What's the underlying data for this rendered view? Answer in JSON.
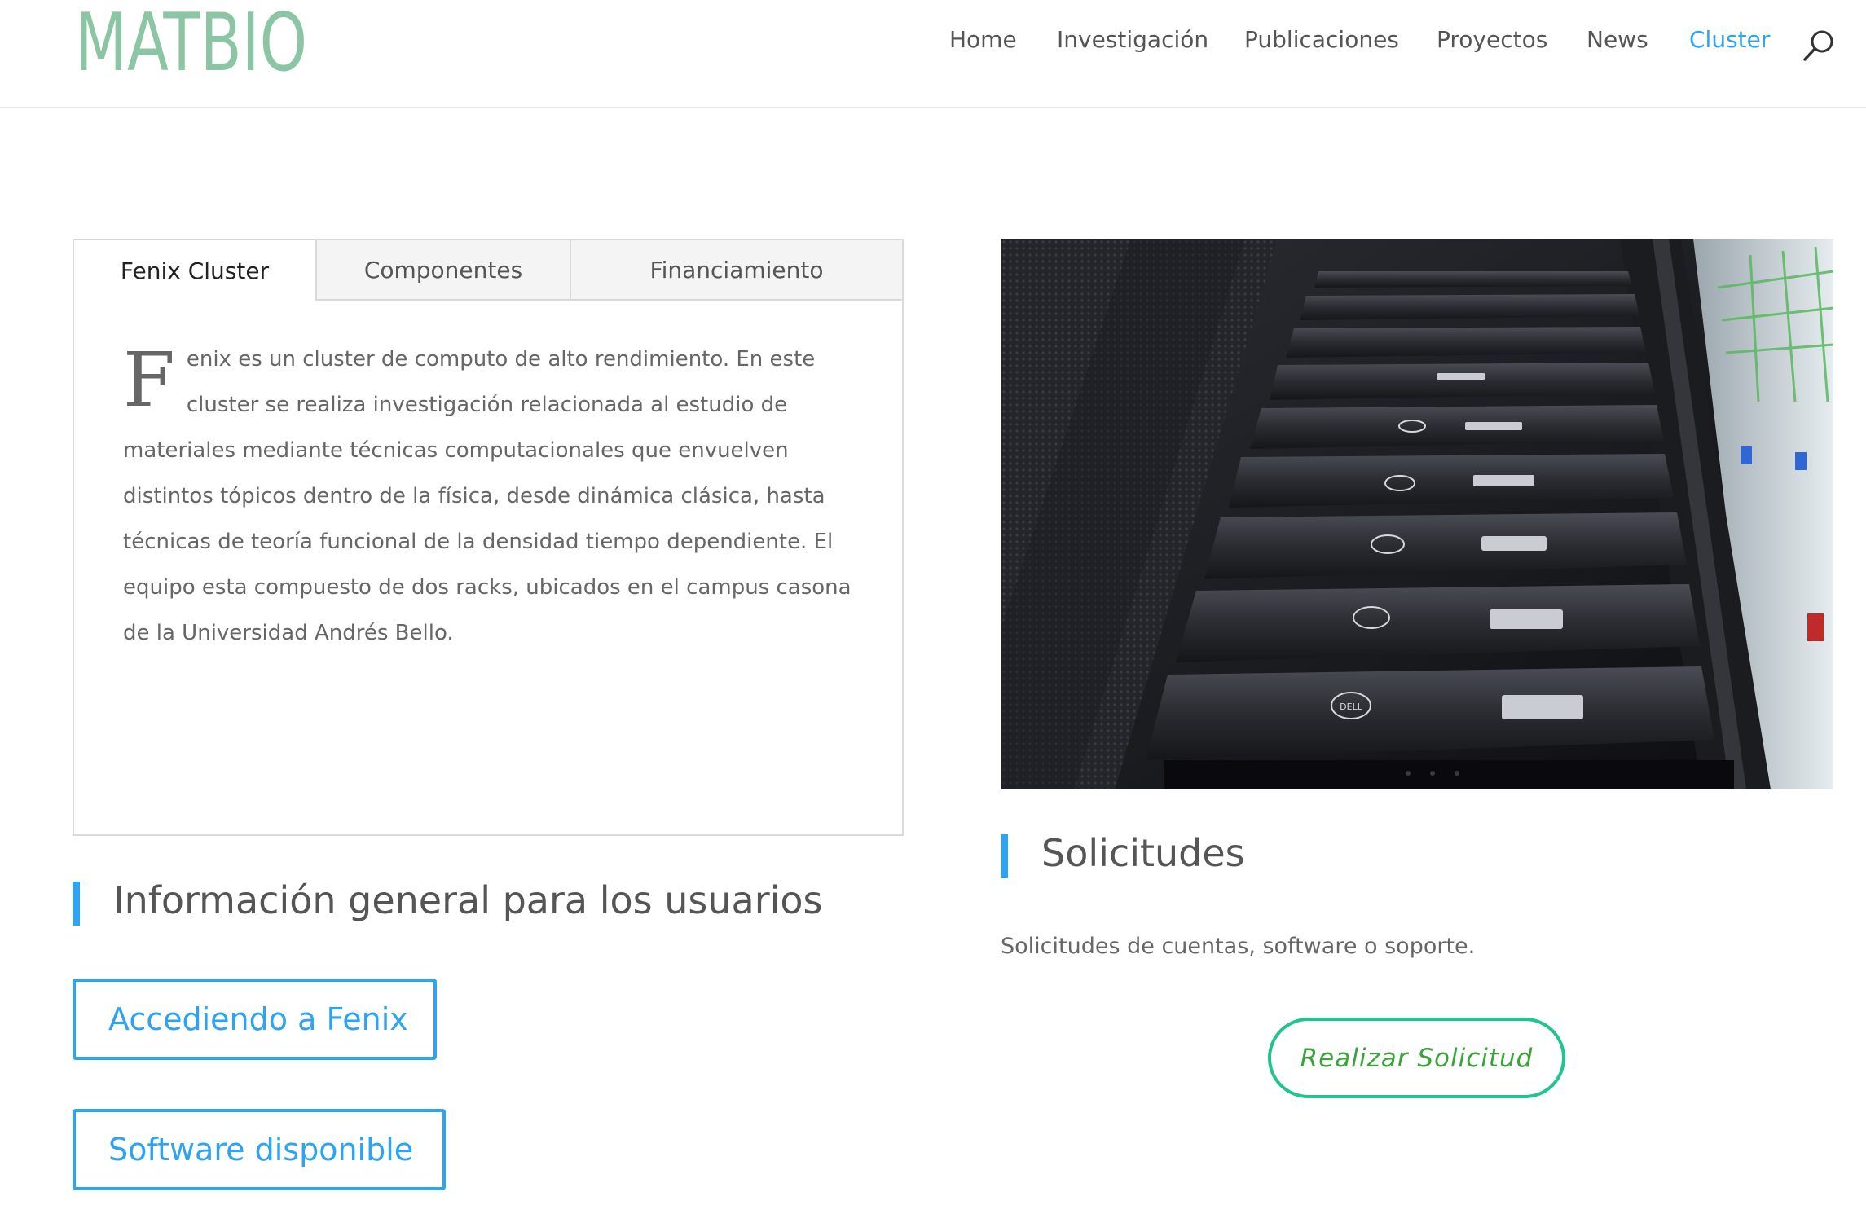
{
  "header": {
    "logo_text": "MATBIO",
    "nav": [
      {
        "label": "Home"
      },
      {
        "label": "Investigación"
      },
      {
        "label": "Publicaciones"
      },
      {
        "label": "Proyectos"
      },
      {
        "label": "News"
      },
      {
        "label": "Cluster",
        "active": true
      }
    ]
  },
  "tabs": {
    "items": [
      {
        "label": "Fenix Cluster",
        "active": true
      },
      {
        "label": "Componentes"
      },
      {
        "label": "Financiamiento"
      }
    ],
    "content": {
      "dropcap": "F",
      "text": "enix es un cluster de computo de alto rendimiento. En este cluster se realiza investigación relacionada al estudio de materiales mediante técnicas computacionales que envuelven distintos tópicos dentro de la física, desde dinámica clásica, hasta técnicas de teoría funcional de la densidad tiempo dependiente. El equipo esta compuesto de dos racks, ubicados en el campus casona de la Universidad Andrés Bello."
    }
  },
  "info_section": {
    "title": "Información general para los usuarios",
    "buttons": [
      {
        "label": "Accediendo a Fenix"
      },
      {
        "label": "Software disponible"
      }
    ]
  },
  "solicitudes": {
    "title": "Solicitudes",
    "text": "Solicitudes de cuentas, software o soporte.",
    "button_label": "Realizar Solicitud"
  },
  "image": {
    "brand_label": "DELL"
  },
  "colors": {
    "accent": "#2ea3f2",
    "logo_green": "#8cc5a3",
    "solicitud_border": "#21c48a",
    "solicitud_text": "#3aa33a",
    "text": "#666666"
  }
}
